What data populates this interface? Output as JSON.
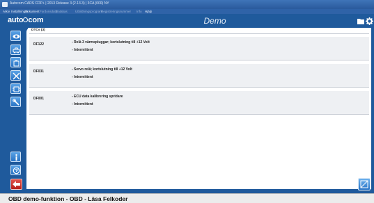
{
  "window": {
    "title": "Autocom CARS CDP+ | 2013 Release 3 (2.13.3) | 3CA (000) NY"
  },
  "menu": {
    "items": [
      "Arkiv",
      "Inställningar",
      "Dokument",
      "Fordonsdata",
      "Databas",
      "Utbildningsprogram",
      "Registreringsnummer",
      "Info",
      "Hjälp"
    ],
    "enabled": [
      true,
      true,
      true,
      false,
      false,
      false,
      false,
      false,
      true
    ]
  },
  "header": {
    "logo_pre": "auto",
    "logo_post": "com",
    "title": "Demo"
  },
  "tab": {
    "label": "DTCs (3)"
  },
  "dtcs": [
    {
      "code": "DF122",
      "description": "- Relä 3 värmepluggar; kortslutning till +12 Volt",
      "status": "- Intermittent"
    },
    {
      "code": "DF031",
      "description": "- Servo relä; kortslutning till +12 Volt",
      "status": "- Intermittent"
    },
    {
      "code": "DF001",
      "description": "- ECU data kalibrering spridare",
      "status": "- Intermittent"
    }
  ],
  "status": {
    "text": "OBD demo-funktion - OBD - Läsa Felkoder"
  },
  "sidebar": {
    "buttons": [
      "eye-icon",
      "car-diagnostics-icon",
      "battery-icon",
      "adjust-icon",
      "ecu-icon",
      "wrench-icon"
    ],
    "bottom": [
      "info-icon",
      "help-icon",
      "back-arrow-icon"
    ]
  },
  "colors": {
    "brand_blue": "#1f5a9c",
    "button_blue": "#2873c4",
    "row_bg": "#eef0f3",
    "back_red": "#c62820"
  }
}
